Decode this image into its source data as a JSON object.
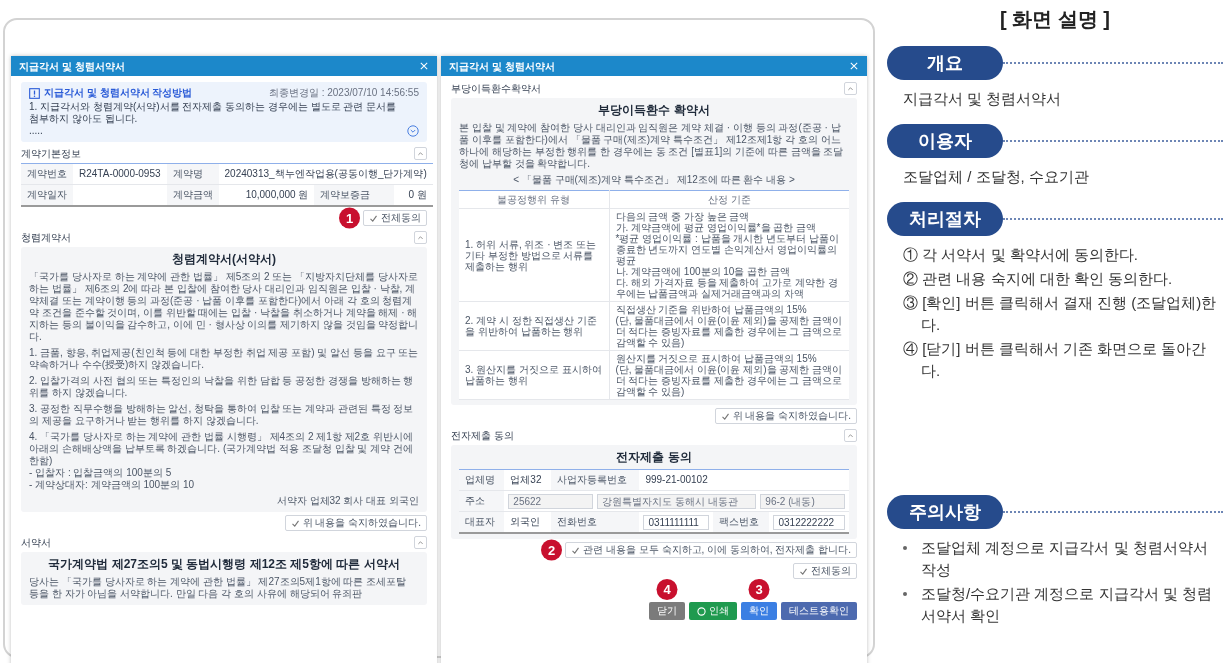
{
  "windows": [
    {
      "title": "지급각서 및 청렴서약서",
      "sections": [
        {
          "kind": "notice",
          "title": "지급각서 및 청렴서약서 작성방법",
          "updated": "최종변경일 : 2023/07/10 14:56:55",
          "lines": [
            "1. 지급각서와 청렴계약(서약)서를 전자제출 동의하는 경우에는 별도로 관련 문서를 첨부하지 않아도 됩니다.",
            "....."
          ]
        },
        {
          "kind": "table",
          "heading": "계약기본정보",
          "rows": [
            [
              {
                "kind": "label",
                "text": "계약번호"
              },
              {
                "kind": "value",
                "text": "R24TA-0000-0953"
              },
              {
                "kind": "label",
                "text": "계약명"
              },
              {
                "kind": "value",
                "text": "20240313_책누엔작업용(공동이행_단가계약)",
                "colspan": 3
              }
            ],
            [
              {
                "kind": "label",
                "text": "계약일자"
              },
              {
                "kind": "value"
              },
              {
                "kind": "label",
                "text": "계약금액"
              },
              {
                "kind": "amount",
                "text": "10,000,000 원"
              },
              {
                "kind": "label",
                "text": "계약보증금"
              },
              {
                "kind": "amount",
                "text": "0 원"
              }
            ]
          ],
          "action": {
            "label": "전체동의",
            "marker": "1"
          }
        },
        {
          "kind": "document",
          "heading": "청렴계약서",
          "title": "청렴계약서(서약서)",
          "blocks": [
            [
              "「국가를 당사자로 하는 계약에 관한 법률」 제5조의 2 또는 「지방자치단체를 당사자로 하는 법률」 제6조의 2에 따라 본 입찰에 참여한 당사 대리인과 임직원은 입찰 · 낙찰, 계약체결 또는 계약이행 등의 과정(준공 · 납품 이후를 포함한다)에서 아래 각 호의 청렴계약 조건을 준수할 것이며, 이를 위반할 때에는 입찰 · 낙찰을 취소하거나 계약을 해제 · 해지하는 등의 불이익을 감수하고, 이에 민 · 형사상 이의를 제기하지 않을 것임을 약정합니다."
            ],
            [
              "1. 금품, 향응, 취업제공(친인척 등에 대한 부정한 취업 제공 포함) 및 알선 등을 요구 또는 약속하거나 수수(授受)하지 않겠습니다."
            ],
            [
              "2. 입찰가격의 사전 협의 또는 특정인의 낙찰을 위한 담합 등 공정한 경쟁을 방해하는 행위를 하지 않겠습니다."
            ],
            [
              "3. 공정한 직무수행을 방해하는 알선, 청탁을 통하여 입찰 또는 계약과 관련된 특정 정보의 제공을 요구하거나 받는 행위를 하지 않겠습니다."
            ],
            [
              "4. 「국가를 당사자로 하는 계약에 관한 법률 시행령」 제4조의 2 제1항 제2호 위반시에 아래의 손해배상액을 납부토록 하겠습니다. (국가계약법 적용 조달청 입찰 및 계약 건에 한함)",
              "- 입찰자 : 입찰금액의 100분의 5",
              "- 계약상대자: 계약금액의 100분의 10"
            ]
          ],
          "signature": "서약자 업체32 회사 대표 외국인",
          "action": {
            "label": "위 내용을 숙지하였습니다."
          }
        },
        {
          "kind": "document",
          "heading": "서약서",
          "title": "국가계약법 제27조의5 및 동법시행령 제12조 제5항에 따른 서약서",
          "blocks": [
            [
              "당사는 「국가를 당사자로 하는 계약에 관한 법률」 제27조의5제1항에 따른 조세포탈 등을 한 자가 아님을 서약합니다. 만일 다음 각 호의 사유에 해당되어 유죄판"
            ]
          ]
        }
      ]
    },
    {
      "title": "지급각서 및 청렴서약서",
      "sections": [
        {
          "kind": "document",
          "heading": "부당이득환수확약서",
          "title": "부당이득환수 확약서",
          "blocks": [
            [
              "본 입찰 및 계약에 참여한 당사 대리인과 임직원은 계약 체결 · 이행 등의 과정(준공 · 납품 이후를 포함한다)에서 「물품 구매(제조)계약 특수조건」 제12조제1항 각 호의 어느 하나에 해당하는 부정한 행위를 한 경우에는 동 조건 [별표1]의 기준에 따른 금액을 조달청에 납부할 것을 확약합니다."
            ]
          ],
          "caption": "< 「물품 구매(제조)계약 특수조건」 제12조에 따른 환수 내용 >",
          "table": {
            "columns": [
              "불공정행위 유형",
              "산정 기준"
            ],
            "rows": [
              {
                "type": "1. 허위 서류, 위조 · 변조 또는 기타 부정한 방법으로 서류를 제출하는 행위",
                "criteria": [
                  "다음의 금액 중 가장 높은 금액",
                  "가. 계약금액에 평균 영업이익률*을 곱한 금액",
                  "*평균 영업이익률 : 납품을 개시한 년도부터 납품이 종료한 년도까지 연도별 손익계산서 영업이익률의 평균",
                  "나. 계약금액에 100분의 10을 곱한 금액",
                  "다. 해외 가격자료 등을 제출하여 고가로 계약한 경우에는 납품금액과 실제거래금액과의 차액"
                ]
              },
              {
                "type": "2. 계약 시 정한 직접생산 기준을 위반하여 납품하는 행위",
                "criteria": [
                  "직접생산 기준을 위반하여 납품금액의 15%",
                  "(단, 물품대금에서 이윤(이윤 제외)을 공제한 금액이 더 적다는 증빙자료를 제출한 경우에는 그 금액으로 감액할 수 있음)"
                ]
              },
              {
                "type": "3. 원산지를 거짓으로 표시하여 납품하는 행위",
                "criteria": [
                  "원산지를 거짓으로 표시하여 납품금액의 15%",
                  "(단, 물품대금에서 이윤(이윤 제외)을 공제한 금액이 더 적다는 증빙자료를 제출한 경우에는 그 금액으로 감액할 수 있음)"
                ]
              }
            ]
          },
          "action": {
            "label": "위 내용을 숙지하였습니다."
          }
        },
        {
          "kind": "form",
          "heading": "전자제출 동의",
          "title": "전자제출 동의",
          "rows": [
            [
              {
                "kind": "label",
                "text": "업체명"
              },
              {
                "kind": "value",
                "text": "업체32"
              },
              {
                "kind": "label",
                "text": "사업자등록번호"
              },
              {
                "kind": "value",
                "text": "999-21-00102",
                "colspan": 3
              }
            ],
            [
              {
                "kind": "label",
                "text": "주소"
              },
              {
                "kind": "fields",
                "values": [
                  "25622",
                  "강원특별자치도 동해시 내동관",
                  "96-2 (내동)"
                ],
                "colspan": 5
              }
            ],
            [
              {
                "kind": "label",
                "text": "대표자"
              },
              {
                "kind": "value",
                "text": "외국인"
              },
              {
                "kind": "label",
                "text": "전화번호"
              },
              {
                "kind": "input",
                "text": "0311111111"
              },
              {
                "kind": "label",
                "text": "팩스번호"
              },
              {
                "kind": "input",
                "text": "0312222222"
              }
            ]
          ],
          "action": {
            "label": "관련 내용을 모두 숙지하고, 이에 동의하여, 전자제출 합니다.",
            "marker": "2"
          }
        },
        {
          "kind": "agree",
          "action": {
            "label": "전체동의"
          }
        },
        {
          "kind": "buttons",
          "buttons": [
            {
              "kind": "close",
              "label": "닫기",
              "marker": "4"
            },
            {
              "kind": "print",
              "label": "인쇄"
            },
            {
              "kind": "confirm",
              "label": "확인",
              "marker": "3"
            },
            {
              "kind": "test",
              "label": "테스트용확인"
            }
          ]
        }
      ]
    }
  ],
  "panel": {
    "title": "[ 화면 설명 ]",
    "sections": [
      {
        "heading": "개요",
        "kind": "text",
        "text": "지급각서 및 청렴서약서"
      },
      {
        "heading": "이용자",
        "kind": "text",
        "text": "조달업체 / 조달청, 수요기관"
      },
      {
        "heading": "처리절차",
        "kind": "steps",
        "items": [
          "① 각 서약서 및 확약서에 동의한다.",
          "② 관련 내용 숙지에 대한 확인 동의한다.",
          "③ [확인] 버튼 클릭해서 결재 진행 (조달업체)한다.",
          "④ [닫기] 버튼 클릭해서 기존 화면으로 돌아간다."
        ]
      },
      {
        "heading": "주의사항",
        "kind": "bullets",
        "items": [
          "조달업체 계정으로 지급각서 및 청렴서약서 작성",
          "조달청/수요기관 계정으로 지급각서 및 청렴서약서 확인"
        ]
      }
    ]
  }
}
